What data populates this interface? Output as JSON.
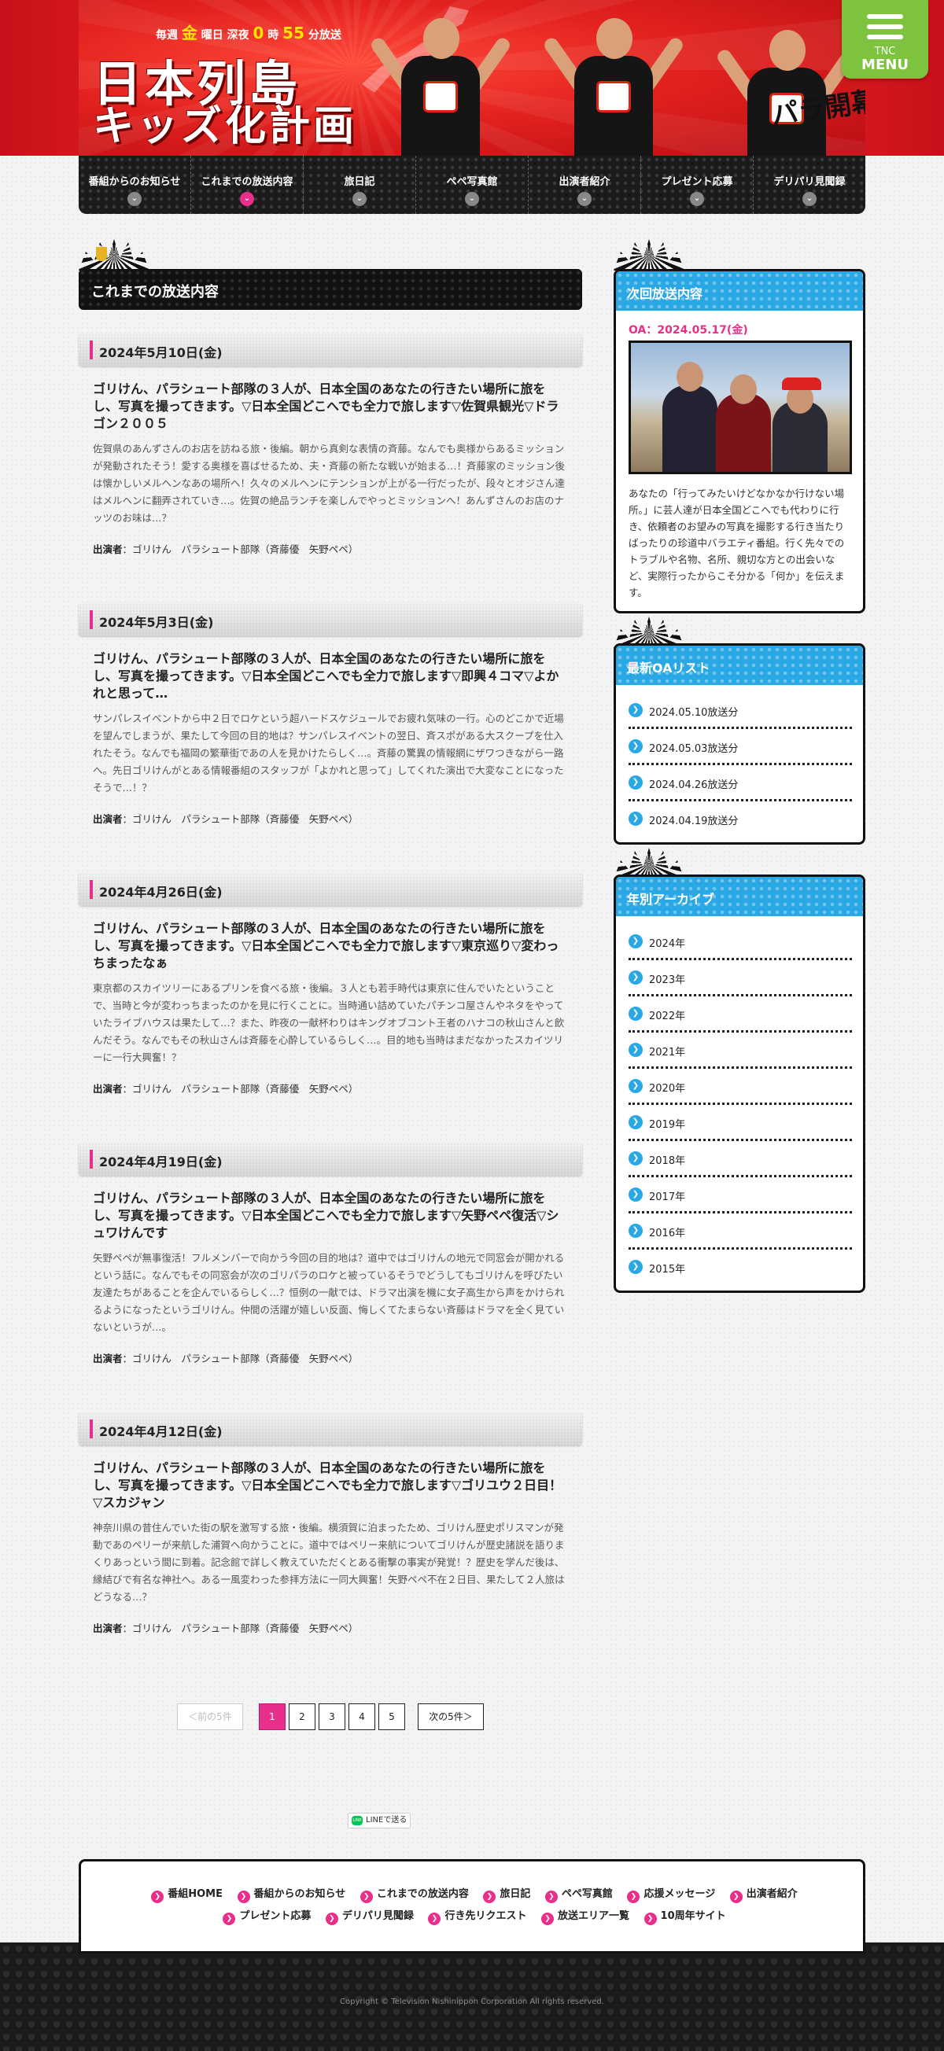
{
  "header": {
    "airtime_prefix": "毎週",
    "airtime_day": "金",
    "airtime_day_suffix": "曜日",
    "airtime_late": "深夜",
    "airtime_hour": "0",
    "airtime_hour_suffix": "時",
    "airtime_min": "55",
    "airtime_min_suffix": "分放送",
    "logo_line1": "日本列島",
    "logo_line2": "キッズ化計画",
    "stamp": "パラ開幕",
    "menu_brand": "TNC",
    "menu_label": "MENU"
  },
  "nav": [
    {
      "label": "番組からのお知らせ",
      "active": false
    },
    {
      "label": "これまでの放送内容",
      "active": true
    },
    {
      "label": "旅日記",
      "active": false
    },
    {
      "label": "ペペ写真館",
      "active": false
    },
    {
      "label": "出演者紹介",
      "active": false
    },
    {
      "label": "プレゼント応募",
      "active": false
    },
    {
      "label": "デリパリ見聞録",
      "active": false
    }
  ],
  "main": {
    "section_title": "これまでの放送内容",
    "cast_label": "出演者",
    "cast_value": "：ゴリけん　パラシュート部隊（斉藤優　矢野ペペ）",
    "entries": [
      {
        "date": "2024年5月10日(金)",
        "title": "ゴリけん、パラシュート部隊の３人が、日本全国のあなたの行きたい場所に旅をし、写真を撮ってきます。▽日本全国どこへでも全力で旅します▽佐賀県観光▽ドラゴン２００５",
        "desc": "佐賀県のあんずさんのお店を訪ねる旅・後編。朝から真剣な表情の斉藤。なんでも奥様からあるミッションが発動されたそう！愛する奥様を喜ばせるため、夫・斉藤の新たな戦いが始まる…！斉藤家のミッション後は懐かしいメルヘンなあの場所へ！久々のメルヘンにテンションが上がる一行だったが、段々とオジさん達はメルヘンに翻弄されていき…。佐賀の絶品ランチを楽しんでやっとミッションへ！あんずさんのお店のナッツのお味は…？"
      },
      {
        "date": "2024年5月3日(金)",
        "title": "ゴリけん、パラシュート部隊の３人が、日本全国のあなたの行きたい場所に旅をし、写真を撮ってきます。▽日本全国どこへでも全力で旅します▽即興４コマ▽よかれと思って…",
        "desc": "サンパレスイベントから中２日でロケという超ハードスケジュールでお疲れ気味の一行。心のどこかで近場を望んでしまうが、果たして今回の目的地は？サンパレスイベントの翌日、斉スポがある大スクープを仕入れたそう。なんでも福岡の繁華街であの人を見かけたらしく…。斉藤の驚異の情報網にザワつきながら一路へ。先日ゴリけんがとある情報番組のスタッフが「よかれと思って」してくれた演出で大変なことになったそうで…！？"
      },
      {
        "date": "2024年4月26日(金)",
        "title": "ゴリけん、パラシュート部隊の３人が、日本全国のあなたの行きたい場所に旅をし、写真を撮ってきます。▽日本全国どこへでも全力で旅します▽東京巡り▽変わっちまったなぁ",
        "desc": "東京都のスカイツリーにあるプリンを食べる旅・後編。３人とも若手時代は東京に住んでいたということで、当時と今が変わっちまったのかを見に行くことに。当時通い詰めていたパチンコ屋さんやネタをやっていたライブハウスは果たして…？また、昨夜の一献杯わりはキングオブコント王者のハナコの秋山さんと飲んだそう。なんでもその秋山さんは斉藤を心酔しているらしく…。目的地も当時はまだなかったスカイツリーに一行大興奮！？"
      },
      {
        "date": "2024年4月19日(金)",
        "title": "ゴリけん、パラシュート部隊の３人が、日本全国のあなたの行きたい場所に旅をし、写真を撮ってきます。▽日本全国どこへでも全力で旅します▽矢野ペペ復活▽シュワけんです",
        "desc": "矢野ペペが無事復活！フルメンバーで向かう今回の目的地は？道中ではゴリけんの地元で同窓会が開かれるという話に。なんでもその同窓会が次のゴリパラのロケと被っているそうでどうしてもゴリけんを呼びたい友達たちがあることを企んでいるらしく…？恒例の一献では、ドラマ出演を機に女子高生から声をかけられるようになったというゴリけん。仲間の活躍が嬉しい反面、悔しくてたまらない斉藤はドラマを全く見ていないというが…。"
      },
      {
        "date": "2024年4月12日(金)",
        "title": "ゴリけん、パラシュート部隊の３人が、日本全国のあなたの行きたい場所に旅をし、写真を撮ってきます。▽日本全国どこへでも全力で旅します▽ゴリユウ２日目！▽スカジャン",
        "desc": "神奈川県の昔住んでいた街の駅を激写する旅・後編。横須賀に泊まったため、ゴリけん歴史ポリスマンが発動であのペリーが来航した浦賀へ向かうことに。道中ではペリー来航についてゴリけんが歴史諸説を語りまくりあっという間に到着。記念館で詳しく教えていただくとある衝撃の事実が発覚！？歴史を学んだ後は、縁結びで有名な神社へ。ある一風変わった参拝方法に一同大興奮！矢野ペペ不在２日目、果たして２人旅はどうなる…？"
      }
    ]
  },
  "pager": {
    "prev": "＜前の5件",
    "pages": [
      "1",
      "2",
      "3",
      "4",
      "5"
    ],
    "current": "1",
    "next": "次の5件＞"
  },
  "share": {
    "line": "LINEで送る",
    "line_icon": "LINE"
  },
  "sidebar": {
    "next_oa": {
      "title": "次回放送内容",
      "date": "OA：2024.05.17(金)",
      "text": "あなたの「行ってみたいけどなかなか行けない場所。」に芸人達が日本全国どこへでも代わりに行き、依頼者のお望みの写真を撮影する行き当たりばったりの珍道中バラエティ番組。行く先々でのトラブルや名物、名所、親切な方との出会いなど、実際行ったからこそ分かる「何か」を伝えます。"
    },
    "latest": {
      "title": "最新OAリスト",
      "items": [
        "2024.05.10放送分",
        "2024.05.03放送分",
        "2024.04.26放送分",
        "2024.04.19放送分"
      ]
    },
    "archive": {
      "title": "年別アーカイブ",
      "items": [
        "2024年",
        "2023年",
        "2022年",
        "2021年",
        "2020年",
        "2019年",
        "2018年",
        "2017年",
        "2016年",
        "2015年"
      ]
    }
  },
  "footer": {
    "links_row1": [
      "番組HOME",
      "番組からのお知らせ",
      "これまでの放送内容",
      "旅日記",
      "ペペ写真館",
      "応援メッセージ",
      "出演者紹介"
    ],
    "links_row2": [
      "プレゼント応募",
      "デリパリ見聞録",
      "行き先リクエスト",
      "放送エリア一覧",
      "10周年サイト"
    ],
    "copyright": "Copyright © Television Nishinippon Corporation All rights reserved."
  },
  "colors": {
    "accent_pink": "#e8308a",
    "accent_blue": "#2aa8e6",
    "header_red": "#e11f22",
    "menu_green": "#7dc33d"
  },
  "icons": [
    "menu-icon",
    "chevron-down-icon",
    "arrow-right-icon",
    "trophy-icon",
    "line-icon"
  ]
}
